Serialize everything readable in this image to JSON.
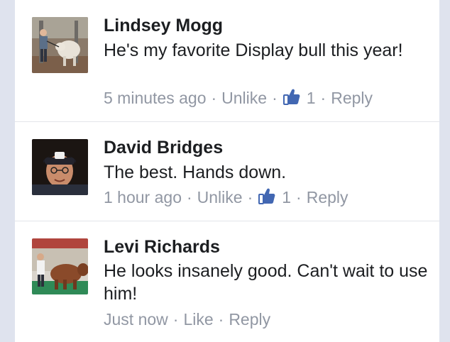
{
  "comments": [
    {
      "author": "Lindsey Mogg",
      "text": "He's my favorite Display bull this year!",
      "time": "5 minutes ago",
      "like_action": "Unlike",
      "like_count": "1",
      "reply": "Reply"
    },
    {
      "author": "David Bridges",
      "text": "The best. Hands down.",
      "time": "1 hour ago",
      "like_action": "Unlike",
      "like_count": "1",
      "reply": "Reply"
    },
    {
      "author": "Levi Richards",
      "text": "He looks insanely good. Can't wait to use him!",
      "time": "Just now",
      "like_action": "Like",
      "like_count": "",
      "reply": "Reply"
    }
  ],
  "separator": "·",
  "colors": {
    "background": "#dfe3ee",
    "panel": "#ffffff",
    "text": "#1c1e21",
    "meta": "#9197a3",
    "like_icon": "#4267b2"
  },
  "icons": {
    "like": "thumbs-up-icon"
  }
}
